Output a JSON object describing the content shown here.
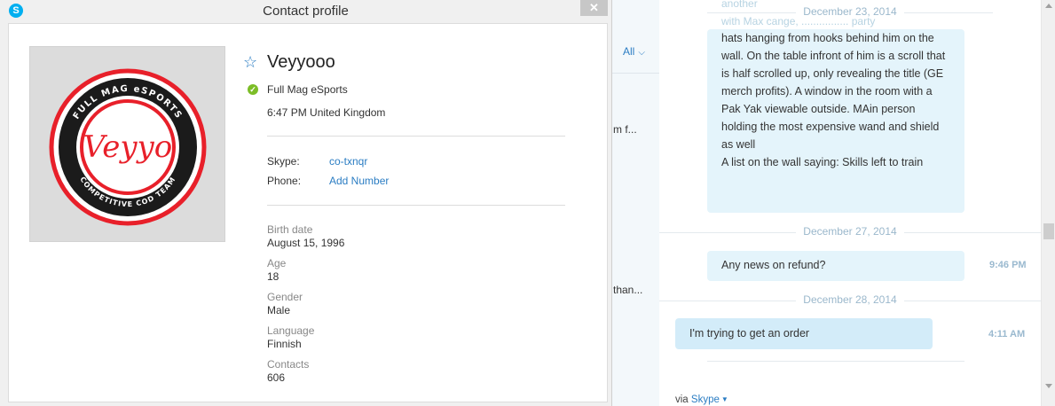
{
  "dialog": {
    "title": "Contact profile",
    "close_label": "✕",
    "skype_glyph": "S"
  },
  "profile": {
    "display_name": "Veyyooo",
    "mood": "Full Mag eSports",
    "local_time": "6:47 PM United Kingdom",
    "avatar_text": {
      "ring_top": "FULL MAG eSPORTS",
      "ring_bottom": "COMPETITIVE COD TEAM",
      "center": "Veyyo"
    },
    "skype_label": "Skype:",
    "skype_value": "co-txnqr",
    "phone_label": "Phone:",
    "phone_value": "Add Number",
    "details": [
      {
        "label": "Birth date",
        "value": "August 15, 1996"
      },
      {
        "label": "Age",
        "value": "18"
      },
      {
        "label": "Gender",
        "value": "Male"
      },
      {
        "label": "Language",
        "value": "Finnish"
      },
      {
        "label": "Contacts",
        "value": "606"
      }
    ]
  },
  "background": {
    "filter_label": "All",
    "snippets": [
      "m f...",
      "than..."
    ]
  },
  "chat": {
    "faded_top": "another\nwith Max cange, ................ party",
    "messages": [
      {
        "date": "December 23, 2014",
        "text": "hats hanging from hooks behind him on the wall. On the table infront of him is a scroll that is half scrolled up, only revealing the title (GE merch profits). A window in the room with a Pak Yak viewable outside. MAin person holding the most expensive wand and shield as well\nA list on the wall saying: Skills left to train",
        "time": ""
      },
      {
        "date": "December 27, 2014",
        "text": "Any news on refund?",
        "time": "9:46 PM"
      },
      {
        "date": "December 28, 2014",
        "text": "I'm trying to get an order",
        "time": "4:11 AM"
      }
    ],
    "via_prefix": "via",
    "via_link": "Skype"
  },
  "colors": {
    "accent": "#2b7dc3",
    "online": "#7cbd27",
    "bubble_out": "#e4f4fb",
    "bubble_in": "#d3ecf9",
    "logo_red": "#e8202a"
  },
  "icons": {
    "favorite": "star-outline-icon",
    "status": "online-check-icon",
    "app": "skype-icon",
    "filter_dropdown": "chevron-down-icon"
  }
}
